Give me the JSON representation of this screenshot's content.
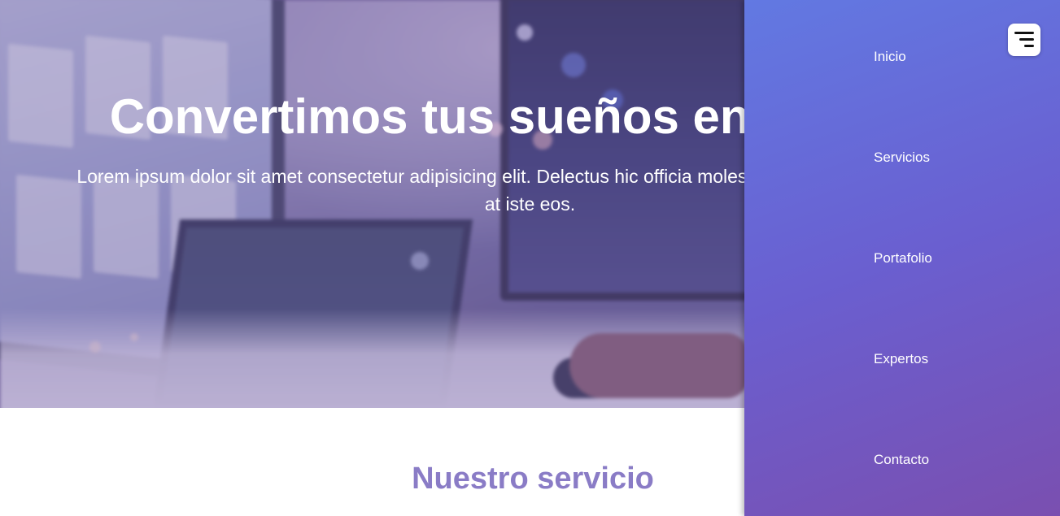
{
  "hero": {
    "title": "Convertimos tus sueños en realidad",
    "subtitle": "Lorem ipsum dolor sit amet consectetur adipisicing elit. Delectus hic officia molestias incidunt, beatae eligendi at iste eos."
  },
  "section": {
    "title": "Nuestro servicio"
  },
  "nav": {
    "items": [
      {
        "label": "Inicio"
      },
      {
        "label": "Servicios"
      },
      {
        "label": "Portafolio"
      },
      {
        "label": "Expertos"
      },
      {
        "label": "Contacto"
      }
    ],
    "toggle_icon": "menu-icon"
  },
  "colors": {
    "menu_gradient_start": "#6279e2",
    "menu_gradient_end": "#7a4fb0",
    "section_title": "#8a7cc6",
    "hero_text": "#ffffff"
  }
}
